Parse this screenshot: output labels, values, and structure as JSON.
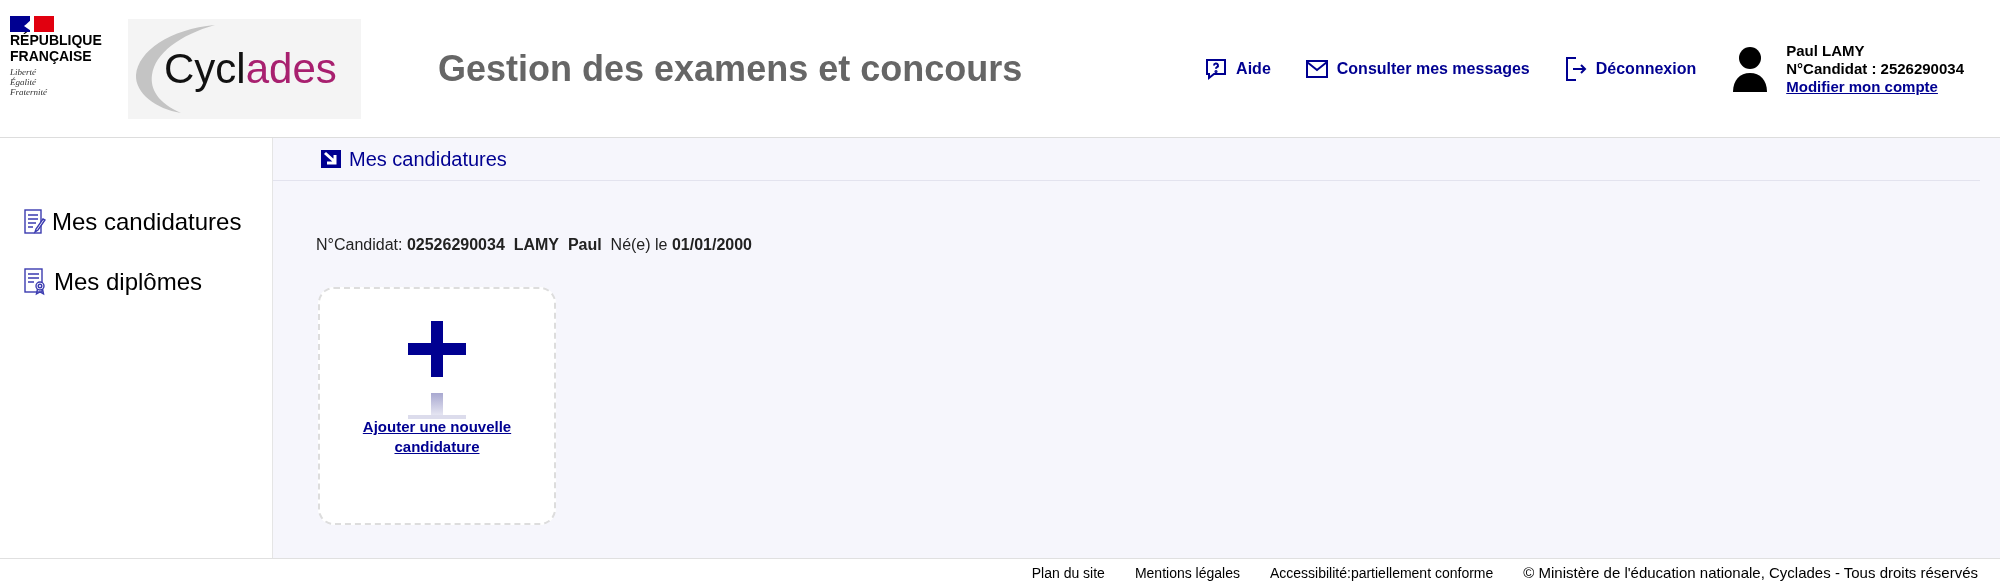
{
  "header": {
    "republic": {
      "name_lines": [
        "RÉPUBLIQUE",
        "FRANÇAISE"
      ],
      "motto": [
        "Liberté",
        "Égalité",
        "Fraternité"
      ]
    },
    "logo": {
      "dark": "Cycl",
      "accent": "ades"
    },
    "title": "Gestion des examens et concours",
    "nav": [
      {
        "kind": "help",
        "label": "Aide"
      },
      {
        "kind": "mail",
        "label": "Consulter mes messages"
      },
      {
        "kind": "logout",
        "label": "Déconnexion"
      }
    ],
    "user": {
      "name": "Paul LAMY",
      "candidate": "N°Candidat : 2526290034",
      "link": "Modifier mon compte"
    }
  },
  "sidebar": {
    "items": [
      {
        "kind": "applications",
        "label": "Mes candidatures"
      },
      {
        "kind": "diplomas",
        "label": "Mes diplômes"
      }
    ]
  },
  "breadcrumb": "Mes candidatures",
  "candidate_line": "N°Candidat: **02526290034**  **LAMY**  **Paul**  Né(e) le **01/01/2000**",
  "add_card": {
    "label": "Ajouter une nouvelle candidature"
  },
  "footer": {
    "links": [
      "Plan du site",
      "Mentions légales",
      "Accessibilité:partiellement conforme"
    ],
    "copyright": "© Ministère de l'éducation nationale, Cyclades - Tous droits réservés"
  }
}
